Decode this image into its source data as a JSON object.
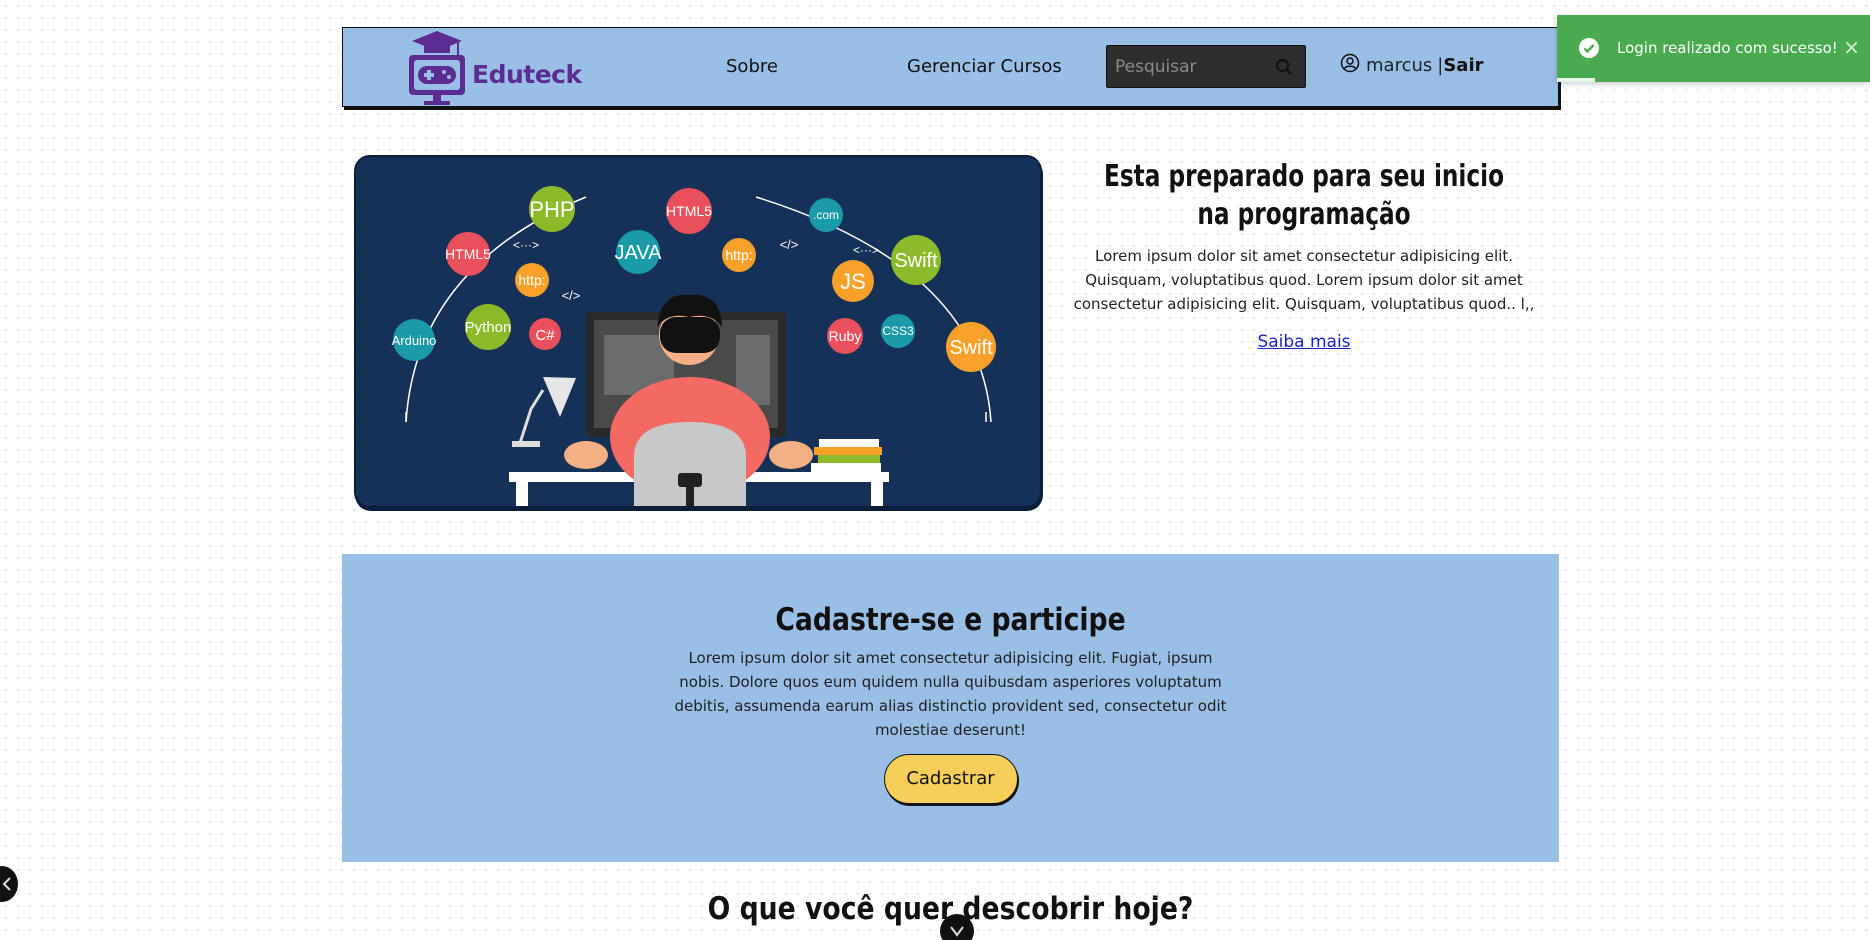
{
  "header": {
    "brand": "Eduteck",
    "nav": [
      {
        "label": "Sobre"
      },
      {
        "label": "Gerenciar Cursos"
      }
    ],
    "search": {
      "placeholder": "Pesquisar",
      "value": ""
    },
    "user": {
      "name": "marcus",
      "separator": "|",
      "logout": "Sair"
    }
  },
  "hero": {
    "title": "Esta preparado para seu inicio na programação",
    "description": "Lorem ipsum dolor sit amet consectetur adipisicing elit. Quisquam, voluptatibus quod. Lorem ipsum dolor sit amet consectetur adipisicing elit. Quisquam, voluptatibus quod.. l,,",
    "link": "Saiba mais",
    "illustration_labels": {
      "php": "PHP",
      "html5_a": "HTML5",
      "html5_b": "HTML5",
      "java": "JAVA",
      "http_a": "http:",
      "http_b": "http:",
      "com": ".com",
      "swift_a": "Swift",
      "swift_b": "Swift",
      "js": "JS",
      "python": "Python",
      "csharp": "C#",
      "arduino": "Arduino",
      "ruby": "Ruby",
      "css3": "CSS3",
      "tag_a": "<···>",
      "tag_b": "</>",
      "tag_c": "</>",
      "tag_d": "<···>"
    }
  },
  "signup": {
    "title": "Cadastre-se e participe",
    "description": "Lorem ipsum dolor sit amet consectetur adipisicing elit. Fugiat, ipsum nobis. Dolore quos eum quidem nulla quibusdam asperiores voluptatum debitis, assumenda earum alias distinctio provident sed, consectetur odit molestiae deserunt!",
    "button": "Cadastrar"
  },
  "discover": {
    "title": "O que você quer descobrir hoje?"
  },
  "toast": {
    "message": "Login realizado com sucesso!",
    "close": "×"
  },
  "colors": {
    "navbar": "#99bfe6",
    "brand": "#5b2d91",
    "button": "#f5cf5a",
    "toast": "#4aaa4f",
    "hero_bg": "#163158"
  },
  "icons": [
    "graduation-cap-gamepad-logo",
    "search-icon",
    "user-circle-icon",
    "check-circle-icon",
    "close-icon",
    "chevron-down-icon"
  ]
}
